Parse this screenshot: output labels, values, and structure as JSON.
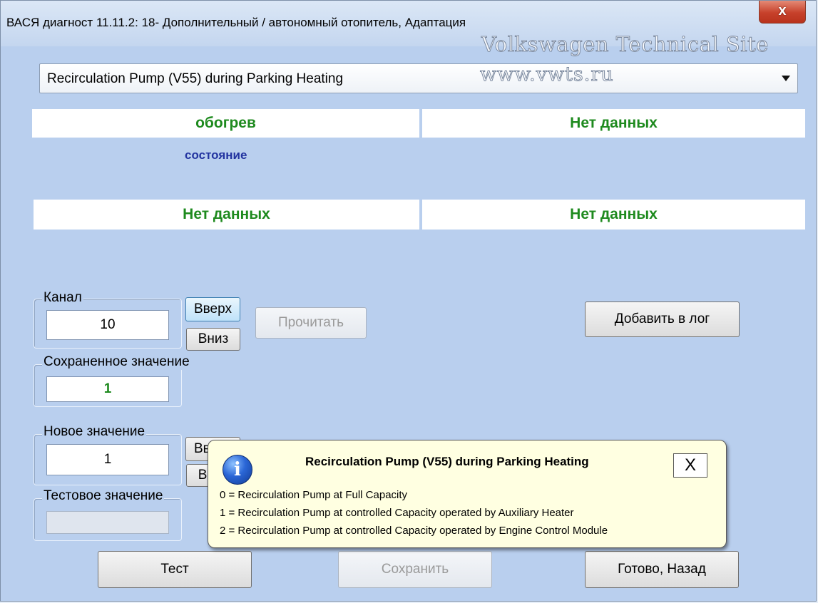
{
  "window": {
    "title": "ВАСЯ диагност 11.11.2: 18- Дополнительный / автономный отопитель, Адаптация",
    "close": "x"
  },
  "watermark": {
    "line1": "Volkswagen Technical Site",
    "line2": "www.vwts.ru"
  },
  "channel_select": {
    "value": "Recirculation Pump (V55) during Parking Heating"
  },
  "fields": {
    "f1_value": "обогрев",
    "f1_label": "состояние",
    "f2_value": "Нет данных",
    "f3_value": "Нет данных",
    "f4_value": "Нет данных"
  },
  "channel": {
    "label": "Канал",
    "value": "10",
    "up": "Вверх",
    "down": "Вниз",
    "read": "Прочитать"
  },
  "add_log": "Добавить в лог",
  "saved": {
    "label": "Сохраненное значение",
    "value": "1"
  },
  "new_value": {
    "label": "Новое значение",
    "value": "1",
    "up": "Вверх",
    "down": "Вниз"
  },
  "test_value": {
    "label": "Тестовое значение",
    "value": ""
  },
  "buttons": {
    "test": "Тест",
    "save": "Сохранить",
    "done": "Готово, Назад"
  },
  "tooltip": {
    "icon": "info-icon",
    "title": "Recirculation Pump (V55) during Parking Heating",
    "close": "X",
    "lines": [
      "0 = Recirculation Pump at Full Capacity",
      "1 = Recirculation Pump at controlled Capacity operated by Auxiliary Heater",
      "2 = Recirculation Pump at controlled Capacity operated by Engine Control Module"
    ]
  },
  "colors": {
    "value_green": "#1e8a1e",
    "label_blue": "#2334a0",
    "window_bg": "#b9cfee"
  }
}
